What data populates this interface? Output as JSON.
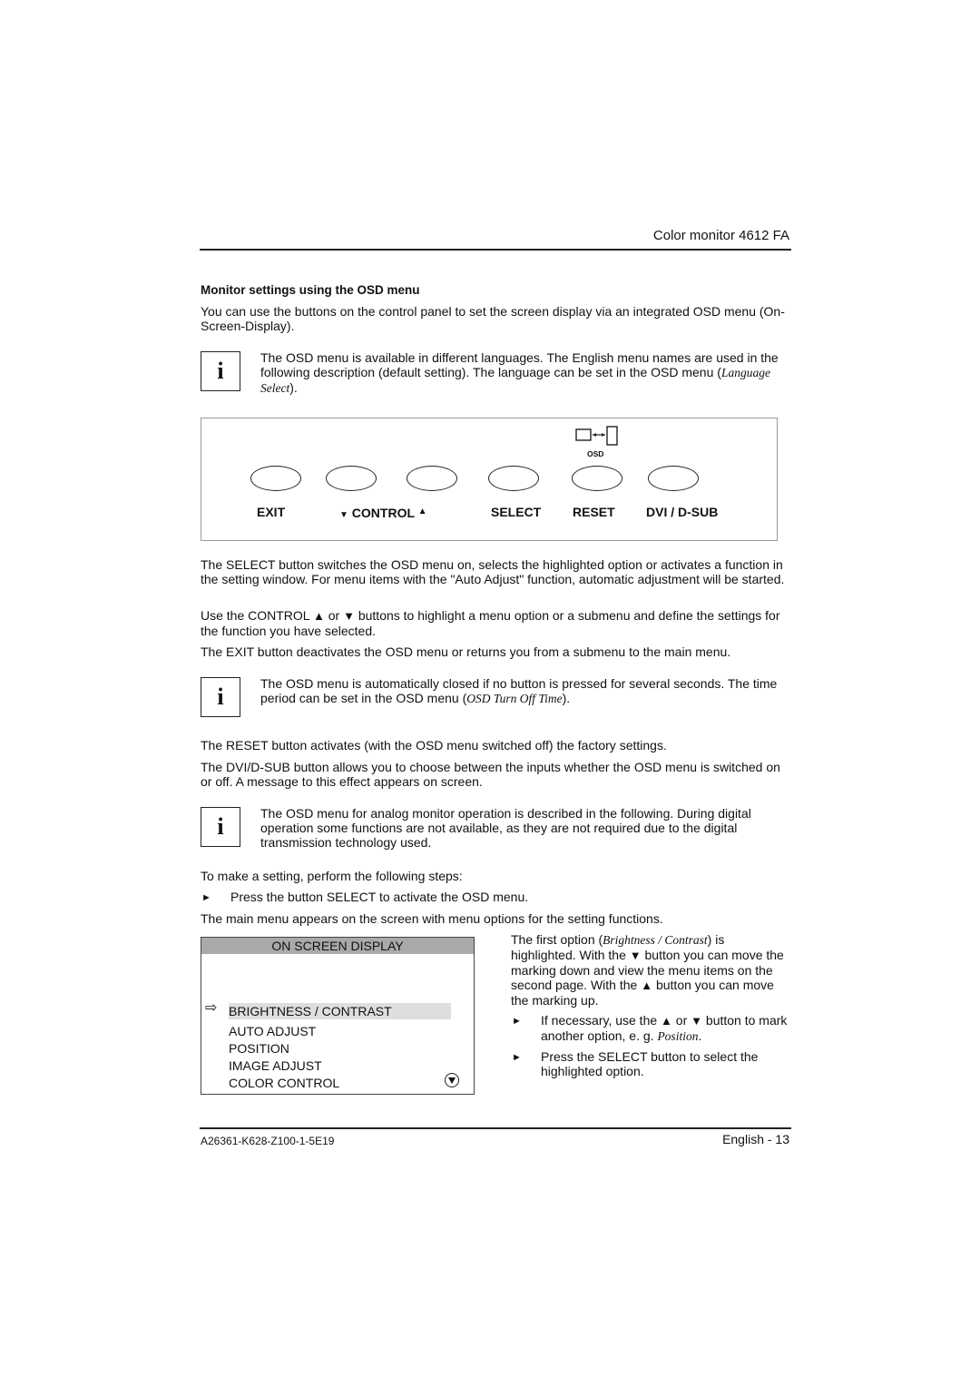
{
  "header": {
    "title": "Color monitor 4612 FA"
  },
  "section": {
    "heading": "Monitor settings using the OSD menu",
    "intro": "You can use the buttons on the control panel to set the screen display via an integrated OSD menu (On-Screen-Display)."
  },
  "notes": [
    {
      "icon": "info-icon",
      "glyph": "i",
      "text": "The OSD menu is available in different languages. The English menu names are used in the following description (default setting). The language can be set in the OSD menu (",
      "italic": "Language Select",
      "tail": ")."
    },
    {
      "icon": "info-icon",
      "glyph": "i",
      "text": "The OSD menu is automatically closed if no button is pressed for several seconds. The time period can be set in the OSD menu (",
      "italic": "OSD Turn Off Time",
      "tail": ")."
    },
    {
      "icon": "info-icon",
      "glyph": "i",
      "text": "The OSD menu for analog monitor operation is described in the following. During digital operation some functions are not available, as they are not required due to the digital transmission technology used.",
      "italic": "",
      "tail": ""
    }
  ],
  "control_panel": {
    "osd_label": "OSD",
    "buttons": [
      {
        "label": "EXIT"
      },
      {
        "label": "CONTROL",
        "down_glyph": "▼",
        "up_glyph": "▲"
      },
      {
        "label": ""
      },
      {
        "label": "SELECT"
      },
      {
        "label": "RESET"
      },
      {
        "label": "DVI / D-SUB"
      }
    ]
  },
  "paragraphs": {
    "select": "The SELECT button switches the OSD menu on, selects the highlighted option or activates a function in the setting window. For menu items with the \"Auto Adjust\" function, automatic adjustment will be started.",
    "control_a": "Use the CONTROL ",
    "control_b": " or ",
    "control_c": " buttons to highlight a menu option or a submenu and define the settings for the function you have selected.",
    "exit": "The EXIT button deactivates the OSD menu or returns you from a submenu to the main menu.",
    "reset": "The RESET button activates (with the OSD menu switched off) the factory settings.",
    "dvi": "The DVI/D-SUB button allows you to choose between the inputs whether the OSD menu is switched on or off. A message to this effect appears on screen.",
    "steps_intro": "To make a setting, perform the following steps:",
    "step1": "Press the button SELECT to activate the OSD menu.",
    "main_menu": "The main menu appears on the screen with menu options for the setting functions."
  },
  "glyphs": {
    "up": "▲",
    "down": "▼",
    "bullet": "►",
    "pointer": "⇨"
  },
  "osd_menu": {
    "title": "ON SCREEN DISPLAY",
    "items": [
      {
        "label": "BRIGHTNESS / CONTRAST",
        "highlighted": true
      },
      {
        "label": "AUTO ADJUST",
        "highlighted": false
      },
      {
        "label": "POSITION",
        "highlighted": false
      },
      {
        "label": "IMAGE ADJUST",
        "highlighted": false
      },
      {
        "label": "COLOR CONTROL",
        "highlighted": false
      }
    ]
  },
  "right_column": {
    "p1_a": "The first option (",
    "p1_italic": "Brightness / Contrast",
    "p1_b": ") is highlighted. With the ",
    "p1_c": " button you can move the marking down and view the menu items on the second page. With the ",
    "p1_d": " button you can move the marking up.",
    "b1_a": "If necessary, use the ",
    "b1_b": " or ",
    "b1_c": " button to mark another option, e. g. ",
    "b1_italic": "Position",
    "b1_d": ".",
    "b2": "Press the SELECT button to select the highlighted option."
  },
  "footer": {
    "doc_id": "A26361-K628-Z100-1-5E19",
    "page": "English - 13"
  }
}
